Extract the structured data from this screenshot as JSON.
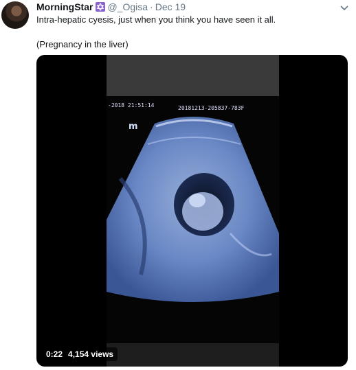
{
  "tweet": {
    "display_name": "MorningStar",
    "badge_icon": "star-of-david-icon",
    "handle": "@_Ogisa",
    "separator": "·",
    "timestamp": "Dec 19",
    "text_line1": "Intra-hepatic cyesis, just when you think you have seen it all.",
    "text_line2": "(Pregnancy in the liver)"
  },
  "video": {
    "duration": "0:22",
    "views": "4,154 views",
    "frame": {
      "datetime_text": "-2018 21:51:14",
      "study_id": "20181213-205837-783F",
      "marker": "m"
    }
  },
  "colors": {
    "accent": "#657786",
    "badge": "#8a63d2",
    "ultrasound_tint": "#7d9cd6"
  }
}
